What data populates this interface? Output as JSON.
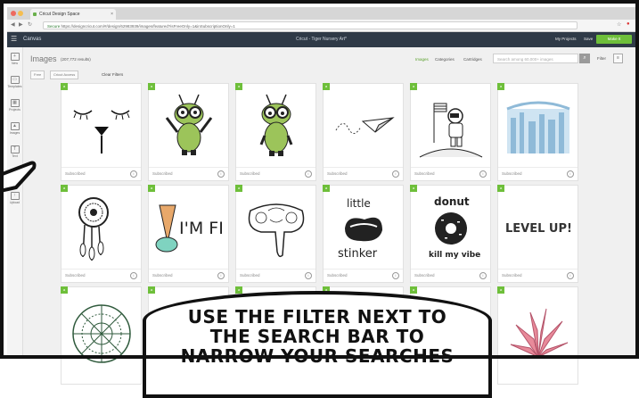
{
  "browser": {
    "tab_title": "Cricut Design Space",
    "tab_close": "×",
    "secure_label": "Secure",
    "url": "https://designcricut.com/#/design/62983939/images/featured?isFreeOnly=1&inSubscriptionOnly=1"
  },
  "header": {
    "brand": "Canvas",
    "project_title": "Cricut - Tiger Nursery Art*",
    "my_projects": "My Projects",
    "save": "Save",
    "make_it": "Make It"
  },
  "rail": {
    "items": [
      {
        "icon": "new-icon",
        "label": "New"
      },
      {
        "icon": "templates-icon",
        "label": "Templates"
      },
      {
        "icon": "projects-icon",
        "label": "Projects"
      },
      {
        "icon": "images-icon",
        "label": "Images"
      },
      {
        "icon": "text-icon",
        "label": "Text"
      },
      {
        "icon": "shapes-icon",
        "label": "Shapes"
      },
      {
        "icon": "upload-icon",
        "label": "Upload"
      }
    ]
  },
  "toolbar": {
    "page_title": "Images",
    "count_label": "(207,772 results)",
    "links": [
      "Images",
      "Categories",
      "Cartridges"
    ],
    "active_link": "Images",
    "search_placeholder": "Search among 60,000+ images",
    "filter_label": "Filter",
    "chips": [
      "Free",
      "Cricut Access"
    ],
    "clear_filters": "Clear Filters"
  },
  "cards": [
    {
      "label": "Subscribed",
      "badge": "a",
      "art": "sleepy-eyes-icon"
    },
    {
      "label": "Subscribed",
      "badge": "a",
      "art": "bug-cheer-icon"
    },
    {
      "label": "Subscribed",
      "badge": "a",
      "art": "bug-stand-icon"
    },
    {
      "label": "Subscribed",
      "badge": "a",
      "art": "paper-plane-icon"
    },
    {
      "label": "Subscribed",
      "badge": "a",
      "art": "astronaut-icon"
    },
    {
      "label": "Subscribed",
      "badge": "a",
      "art": "city-mandala-icon"
    },
    {
      "label": "Subscribed",
      "badge": "a",
      "art": "dreamcatcher-icon"
    },
    {
      "label": "Subscribed",
      "badge": "a",
      "art": "im-fine-icecream-icon"
    },
    {
      "label": "Subscribed",
      "badge": "a",
      "art": "elephant-icon"
    },
    {
      "label": "Subscribed",
      "badge": "a",
      "art": "skunk-icon"
    },
    {
      "label": "Subscribed",
      "badge": "a",
      "art": "donut-icon"
    },
    {
      "label": "Subscribed",
      "badge": "a",
      "art": "level-up-icon"
    },
    {
      "label": "",
      "badge": "a",
      "art": "mandala-icon"
    },
    {
      "label": "",
      "badge": "a",
      "art": "blank"
    },
    {
      "label": "",
      "badge": "a",
      "art": "blank"
    },
    {
      "label": "",
      "badge": "a",
      "art": "blank"
    },
    {
      "label": "",
      "badge": "a",
      "art": "blank"
    },
    {
      "label": "",
      "badge": "a",
      "art": "pink-plant-icon"
    }
  ],
  "art_text": {
    "im_fine": "I'M FINE",
    "little": "little",
    "stinker": "stinker",
    "donut": "donut",
    "kill_my_vibe": "kill my vibe",
    "level_up": "LEVEL UP!"
  },
  "comic": {
    "lines": [
      "USE THE FILTER NEXT TO",
      "THE SEARCH BAR TO",
      "NARROW YOUR SEARCHES"
    ]
  },
  "colors": {
    "accent_green": "#6ebf3a",
    "header_bg": "#2f3a47",
    "pink_plant": "#e88a9a"
  }
}
